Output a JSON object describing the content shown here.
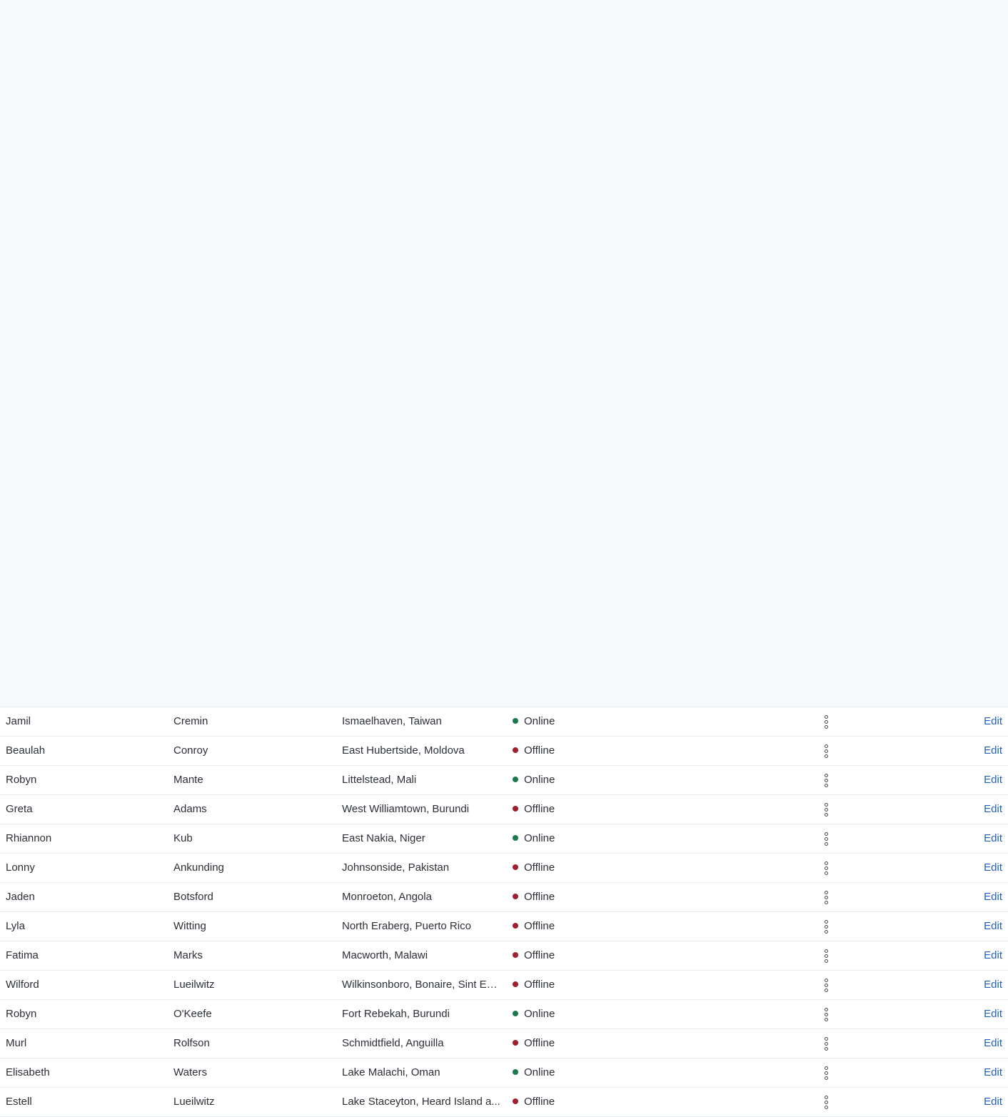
{
  "colors": {
    "online": "#1a7a4c",
    "offline": "#a0202e",
    "link": "#1f5fbf"
  },
  "rows": [
    {
      "first": "Jamil",
      "last": "Cremin",
      "location": "Ismaelhaven, Taiwan",
      "status": "Online",
      "action": "Edit"
    },
    {
      "first": "Beaulah",
      "last": "Conroy",
      "location": "East Hubertside, Moldova",
      "status": "Offline",
      "action": "Edit"
    },
    {
      "first": "Robyn",
      "last": "Mante",
      "location": "Littelstead, Mali",
      "status": "Online",
      "action": "Edit"
    },
    {
      "first": "Greta",
      "last": "Adams",
      "location": "West Williamtown, Burundi",
      "status": "Offline",
      "action": "Edit"
    },
    {
      "first": "Rhiannon",
      "last": "Kub",
      "location": "East Nakia, Niger",
      "status": "Online",
      "action": "Edit"
    },
    {
      "first": "Lonny",
      "last": "Ankunding",
      "location": "Johnsonside, Pakistan",
      "status": "Offline",
      "action": "Edit"
    },
    {
      "first": "Jaden",
      "last": "Botsford",
      "location": "Monroeton, Angola",
      "status": "Offline",
      "action": "Edit"
    },
    {
      "first": "Lyla",
      "last": "Witting",
      "location": "North Eraberg, Puerto Rico",
      "status": "Offline",
      "action": "Edit"
    },
    {
      "first": "Fatima",
      "last": "Marks",
      "location": "Macworth, Malawi",
      "status": "Offline",
      "action": "Edit"
    },
    {
      "first": "Wilford",
      "last": "Lueilwitz",
      "location": "Wilkinsonboro, Bonaire, Sint Eu...",
      "status": "Offline",
      "action": "Edit"
    },
    {
      "first": "Robyn",
      "last": "O'Keefe",
      "location": "Fort Rebekah, Burundi",
      "status": "Online",
      "action": "Edit"
    },
    {
      "first": "Murl",
      "last": "Rolfson",
      "location": "Schmidtfield, Anguilla",
      "status": "Offline",
      "action": "Edit"
    },
    {
      "first": "Elisabeth",
      "last": "Waters",
      "location": "Lake Malachi, Oman",
      "status": "Online",
      "action": "Edit"
    },
    {
      "first": "Estell",
      "last": "Lueilwitz",
      "location": "Lake Staceyton, Heard Island a...",
      "status": "Offline",
      "action": "Edit"
    }
  ]
}
